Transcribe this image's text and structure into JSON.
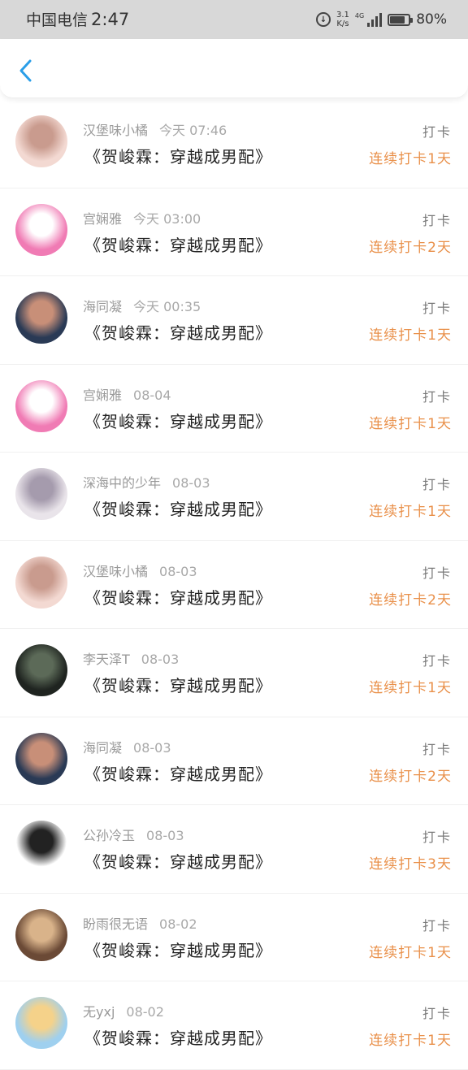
{
  "status_bar": {
    "carrier": "中国电信",
    "time": "2:47",
    "speed_value": "3.1",
    "speed_unit": "K/s",
    "network": "4G",
    "battery_label": "80%",
    "battery_level": 0.8
  },
  "header": {
    "back_icon": "chevron-left-icon",
    "accent_color": "#2a9ee8"
  },
  "entries": [
    {
      "name": "汉堡味小橘",
      "date": "今天 07:46",
      "title": "《贺峻霖：穿越成男配》",
      "action": "打卡",
      "streak": "连续打卡1天",
      "avatar_colors": [
        "#f3d9d2",
        "#c99b8e"
      ]
    },
    {
      "name": "宫娴雅",
      "date": "今天 03:00",
      "title": "《贺峻霖：穿越成男配》",
      "action": "打卡",
      "streak": "连续打卡2天",
      "avatar_colors": [
        "#f07bb4",
        "#ffffff"
      ]
    },
    {
      "name": "海同凝",
      "date": "今天 00:35",
      "title": "《贺峻霖：穿越成男配》",
      "action": "打卡",
      "streak": "连续打卡1天",
      "avatar_colors": [
        "#2a3a55",
        "#c88f78"
      ]
    },
    {
      "name": "宫娴雅",
      "date": "08-04",
      "title": "《贺峻霖：穿越成男配》",
      "action": "打卡",
      "streak": "连续打卡1天",
      "avatar_colors": [
        "#f07bb4",
        "#ffffff"
      ]
    },
    {
      "name": "深海中的少年",
      "date": "08-03",
      "title": "《贺峻霖：穿越成男配》",
      "action": "打卡",
      "streak": "连续打卡1天",
      "avatar_colors": [
        "#e9e4ea",
        "#a59bad"
      ]
    },
    {
      "name": "汉堡味小橘",
      "date": "08-03",
      "title": "《贺峻霖：穿越成男配》",
      "action": "打卡",
      "streak": "连续打卡2天",
      "avatar_colors": [
        "#f3d9d2",
        "#c99b8e"
      ]
    },
    {
      "name": "李天泽T",
      "date": "08-03",
      "title": "《贺峻霖：穿越成男配》",
      "action": "打卡",
      "streak": "连续打卡1天",
      "avatar_colors": [
        "#1f2420",
        "#5c6a58"
      ]
    },
    {
      "name": "海同凝",
      "date": "08-03",
      "title": "《贺峻霖：穿越成男配》",
      "action": "打卡",
      "streak": "连续打卡2天",
      "avatar_colors": [
        "#2a3a55",
        "#c88f78"
      ]
    },
    {
      "name": "公孙冷玉",
      "date": "08-03",
      "title": "《贺峻霖：穿越成男配》",
      "action": "打卡",
      "streak": "连续打卡3天",
      "avatar_colors": [
        "#ffffff",
        "#222222"
      ]
    },
    {
      "name": "盼雨很无语",
      "date": "08-02",
      "title": "《贺峻霖：穿越成男配》",
      "action": "打卡",
      "streak": "连续打卡1天",
      "avatar_colors": [
        "#6b4a36",
        "#d9b38a"
      ]
    },
    {
      "name": "无yxj",
      "date": "08-02",
      "title": "《贺峻霖：穿越成男配》",
      "action": "打卡",
      "streak": "连续打卡1天",
      "avatar_colors": [
        "#9fd0ef",
        "#f5d28a"
      ]
    }
  ]
}
